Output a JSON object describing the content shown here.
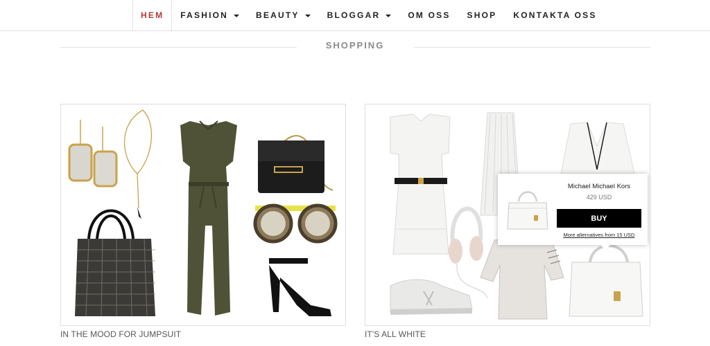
{
  "nav": {
    "items": [
      {
        "label": "HEM",
        "active": true,
        "dropdown": false
      },
      {
        "label": "FASHION",
        "active": false,
        "dropdown": true
      },
      {
        "label": "BEAUTY",
        "active": false,
        "dropdown": true
      },
      {
        "label": "BLOGGAR",
        "active": false,
        "dropdown": true
      },
      {
        "label": "OM OSS",
        "active": false,
        "dropdown": false
      },
      {
        "label": "SHOP",
        "active": false,
        "dropdown": false
      },
      {
        "label": "KONTAKTA OSS",
        "active": false,
        "dropdown": false
      }
    ]
  },
  "section": {
    "title": "SHOPPING"
  },
  "collages": [
    {
      "caption": "IN THE MOOD FOR JUMPSUIT"
    },
    {
      "caption": "IT'S ALL WHITE"
    }
  ],
  "popup": {
    "brand": "Michael Michael Kors",
    "price": "429 USD",
    "buy_label": "BUY",
    "alternatives_label": "More alternatives from 15 USD"
  },
  "colors": {
    "accent": "#b03a3a",
    "olive": "#4f5236",
    "buy_button": "#000000"
  }
}
